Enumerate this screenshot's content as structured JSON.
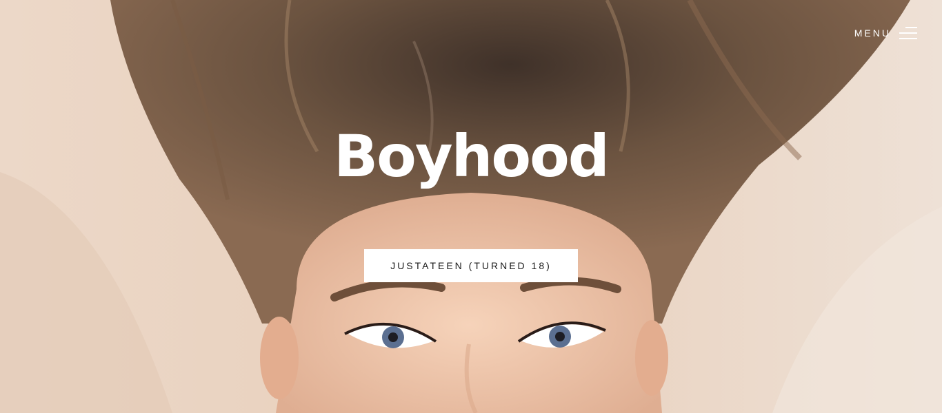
{
  "header": {
    "menu_label": "MENU",
    "menu_icon": "hamburger-icon"
  },
  "hero": {
    "title": "Boyhood",
    "button_label": "JUSTATEEN (TURNED 18)",
    "image": "portrait-photo"
  },
  "colors": {
    "background": "#e9d6c6",
    "hair": "#5a4432",
    "skin": "#f0c9ae",
    "text": "#ffffff",
    "button_bg": "#ffffff",
    "button_text": "#1a1a1a"
  }
}
